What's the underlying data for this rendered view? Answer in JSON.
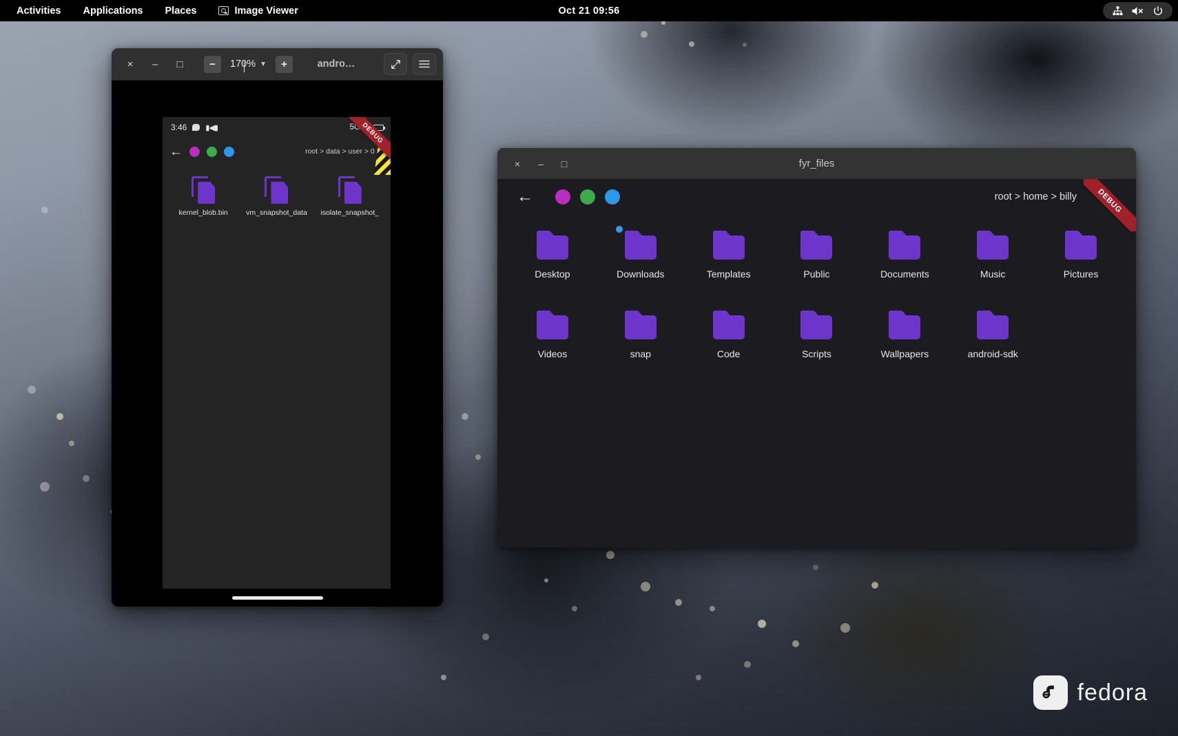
{
  "topbar": {
    "activities": "Activities",
    "applications": "Applications",
    "places": "Places",
    "app_name": "Image Viewer",
    "app_icon": "image-viewer-icon",
    "clock": "Oct 21  09:56",
    "status_icons": [
      "network-icon",
      "volume-muted-icon",
      "power-icon"
    ]
  },
  "image_viewer": {
    "title": "andro…",
    "controls": {
      "close": "×",
      "minimize": "–",
      "maximize": "□",
      "zoom_out": "−",
      "zoom_in": "+",
      "zoom_level": "170%",
      "zoom_caret": "⌄",
      "fullscreen": "⤡",
      "menu": "≡"
    },
    "screenshot": {
      "debug_ribbon": "DEBUG",
      "status_bar": {
        "time": "3:46",
        "network": "5G",
        "icons": [
          "chat-bubble-icon",
          "media-icon",
          "signal-icon",
          "battery-icon"
        ]
      },
      "toolbar": {
        "back": "←",
        "breadcrumb": "root > data > user > 0 > c",
        "circles": [
          "#b92ec0",
          "#3faa4c",
          "#2f97e8"
        ]
      },
      "files": [
        {
          "name": "kernel_blob.bin",
          "icon": "file-icon"
        },
        {
          "name": "vm_snapshot_data",
          "icon": "file-icon"
        },
        {
          "name": "isolate_snapshot_",
          "icon": "file-icon"
        }
      ]
    }
  },
  "fyr_files": {
    "title": "fyr_files",
    "controls": {
      "close": "×",
      "minimize": "–",
      "maximize": "□"
    },
    "toolbar": {
      "back": "←",
      "breadcrumb": "root > home > billy",
      "circles": [
        "#b92ec0",
        "#3faa4c",
        "#2f97e8"
      ]
    },
    "debug_ribbon": "DEBUG",
    "folders": [
      {
        "name": "Desktop",
        "badge": false
      },
      {
        "name": "Downloads",
        "badge": true
      },
      {
        "name": "Templates",
        "badge": false
      },
      {
        "name": "Public",
        "badge": false
      },
      {
        "name": "Documents",
        "badge": false
      },
      {
        "name": "Music",
        "badge": false
      },
      {
        "name": "Pictures",
        "badge": false
      },
      {
        "name": "Videos",
        "badge": false
      },
      {
        "name": "snap",
        "badge": false
      },
      {
        "name": "Code",
        "badge": false
      },
      {
        "name": "Scripts",
        "badge": false
      },
      {
        "name": "Wallpapers",
        "badge": false
      },
      {
        "name": "android-sdk",
        "badge": false
      }
    ]
  },
  "desktop": {
    "watermark": "fedora",
    "logo_icon": "fedora-logo-icon"
  },
  "colors": {
    "accent_purple": "#6d35c9",
    "badge_blue": "#3399e8",
    "debug_red": "#a1202a"
  }
}
